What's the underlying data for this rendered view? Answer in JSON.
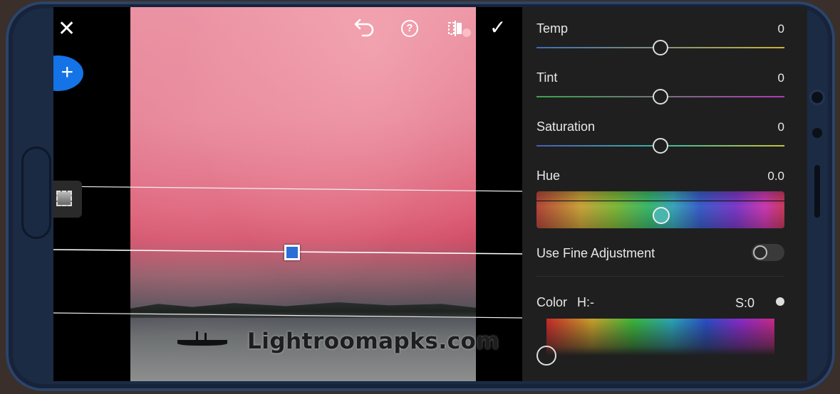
{
  "toolbar": {
    "close_icon": "close-icon",
    "undo_icon": "undo-icon",
    "help_label": "?",
    "compare_icon": "compare-icon",
    "done_icon": "checkmark-icon"
  },
  "masking": {
    "add_label": "+",
    "tool_icon": "linear-gradient-mask-icon"
  },
  "watermark": "Lightroomapks.com",
  "panel": {
    "temp": {
      "label": "Temp",
      "value": "0",
      "level": 0.5
    },
    "tint": {
      "label": "Tint",
      "value": "0",
      "level": 0.5
    },
    "saturation": {
      "label": "Saturation",
      "value": "0",
      "level": 0.5
    },
    "hue": {
      "label": "Hue",
      "value": "0.0",
      "level": 0.5
    },
    "fine_adjustment": {
      "label": "Use Fine Adjustment",
      "enabled": false
    },
    "color": {
      "label": "Color",
      "h": "H:-",
      "s": "S:0"
    }
  },
  "colors": {
    "accent": "#1473e6",
    "panel_bg": "#1f1f1f",
    "mask_handle": "#2b6fd6"
  }
}
